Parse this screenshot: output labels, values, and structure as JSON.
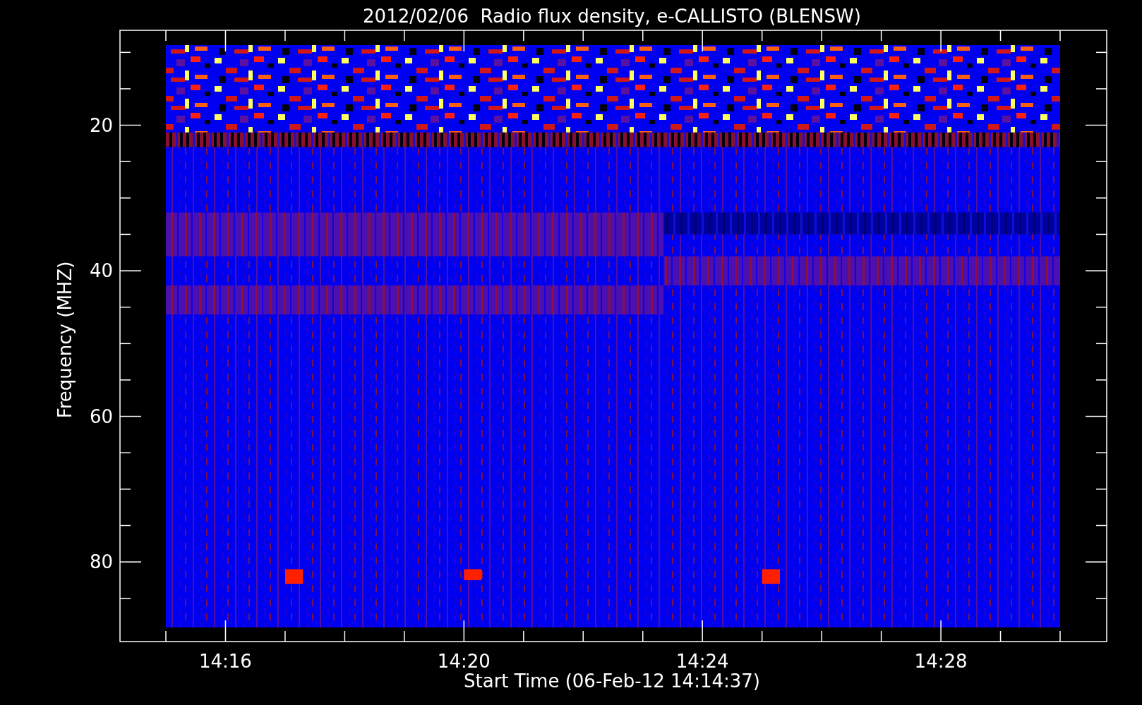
{
  "chart": {
    "title": "2012/02/06  Radio flux density, e-CALLISTO (BLENSW)",
    "xlabel": "Start Time (06-Feb-12 14:14:37)",
    "ylabel": "Frequency (MHZ)",
    "xticks": [
      "14:16",
      "14:20",
      "14:24",
      "14:28"
    ],
    "yticks": [
      "20",
      "40",
      "60",
      "80"
    ]
  }
}
